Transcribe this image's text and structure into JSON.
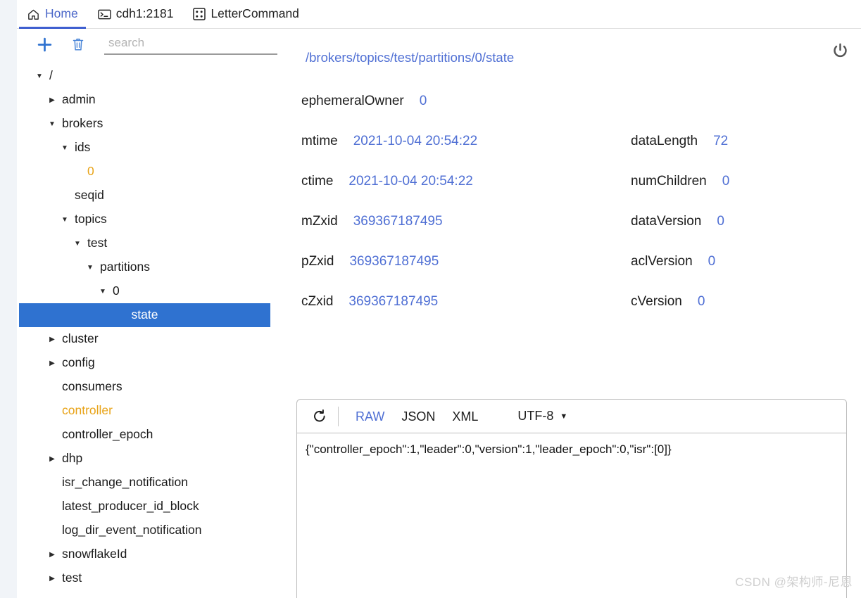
{
  "tabs": [
    {
      "label": "Home",
      "icon": "home-icon",
      "active": true
    },
    {
      "label": "cdh1:2181",
      "icon": "terminal-icon",
      "active": false
    },
    {
      "label": "LetterCommand",
      "icon": "grid-icon",
      "active": false
    }
  ],
  "sidebar": {
    "toolbar": {
      "add_label": "+",
      "delete_label": "delete",
      "search_placeholder": "search",
      "search_value": ""
    },
    "tree": [
      {
        "label": "/",
        "depth": 0,
        "caret": "down",
        "state": "normal",
        "selected": false
      },
      {
        "label": "admin",
        "depth": 1,
        "caret": "right",
        "state": "normal",
        "selected": false
      },
      {
        "label": "brokers",
        "depth": 1,
        "caret": "down",
        "state": "normal",
        "selected": false
      },
      {
        "label": "ids",
        "depth": 2,
        "caret": "down",
        "state": "normal",
        "selected": false
      },
      {
        "label": "0",
        "depth": 3,
        "caret": "none",
        "state": "ephemeral",
        "selected": false
      },
      {
        "label": "seqid",
        "depth": 2,
        "caret": "none",
        "state": "normal",
        "selected": false
      },
      {
        "label": "topics",
        "depth": 2,
        "caret": "down",
        "state": "normal",
        "selected": false
      },
      {
        "label": "test",
        "depth": 3,
        "caret": "down",
        "state": "normal",
        "selected": false
      },
      {
        "label": "partitions",
        "depth": 4,
        "caret": "down",
        "state": "normal",
        "selected": false
      },
      {
        "label": "0",
        "depth": 5,
        "caret": "down",
        "state": "normal",
        "selected": false
      },
      {
        "label": "state",
        "depth": 6,
        "caret": "none",
        "state": "normal",
        "selected": true
      },
      {
        "label": "cluster",
        "depth": 1,
        "caret": "right",
        "state": "normal",
        "selected": false
      },
      {
        "label": "config",
        "depth": 1,
        "caret": "right",
        "state": "normal",
        "selected": false
      },
      {
        "label": "consumers",
        "depth": 1,
        "caret": "none",
        "state": "normal",
        "selected": false
      },
      {
        "label": "controller",
        "depth": 1,
        "caret": "none",
        "state": "ephemeral",
        "selected": false
      },
      {
        "label": "controller_epoch",
        "depth": 1,
        "caret": "none",
        "state": "normal",
        "selected": false
      },
      {
        "label": "dhp",
        "depth": 1,
        "caret": "right",
        "state": "normal",
        "selected": false
      },
      {
        "label": "isr_change_notification",
        "depth": 1,
        "caret": "none",
        "state": "normal",
        "selected": false
      },
      {
        "label": "latest_producer_id_block",
        "depth": 1,
        "caret": "none",
        "state": "normal",
        "selected": false
      },
      {
        "label": "log_dir_event_notification",
        "depth": 1,
        "caret": "none",
        "state": "normal",
        "selected": false
      },
      {
        "label": "snowflakeId",
        "depth": 1,
        "caret": "right",
        "state": "normal",
        "selected": false
      },
      {
        "label": "test",
        "depth": 1,
        "caret": "right",
        "state": "normal",
        "selected": false
      }
    ]
  },
  "main": {
    "path": "/brokers/topics/test/partitions/0/state",
    "meta_rows": [
      {
        "left_key": "ephemeralOwner",
        "left_value": "0",
        "right_key": "",
        "right_value": ""
      },
      {
        "left_key": "mtime",
        "left_value": "2021-10-04 20:54:22",
        "right_key": "dataLength",
        "right_value": "72"
      },
      {
        "left_key": "ctime",
        "left_value": "2021-10-04 20:54:22",
        "right_key": "numChildren",
        "right_value": "0"
      },
      {
        "left_key": "mZxid",
        "left_value": "369367187495",
        "right_key": "dataVersion",
        "right_value": "0"
      },
      {
        "left_key": "pZxid",
        "left_value": "369367187495",
        "right_key": "aclVersion",
        "right_value": "0"
      },
      {
        "left_key": "cZxid",
        "left_value": "369367187495",
        "right_key": "cVersion",
        "right_value": "0"
      }
    ]
  },
  "viewer": {
    "refresh_label": "refresh",
    "formats": [
      {
        "label": "RAW",
        "active": true
      },
      {
        "label": "JSON",
        "active": false
      },
      {
        "label": "XML",
        "active": false
      }
    ],
    "encoding": "UTF-8",
    "content": "{\"controller_epoch\":1,\"leader\":0,\"version\":1,\"leader_epoch\":0,\"isr\":[0]}"
  },
  "power_label": "disconnect",
  "watermark": "CSDN @架构师-尼恩",
  "colors": {
    "accent_blue": "#2f72d0",
    "link_blue": "#4f6fd4",
    "ephemeral_orange": "#e8a317",
    "tab_active": "#4a66c8"
  }
}
